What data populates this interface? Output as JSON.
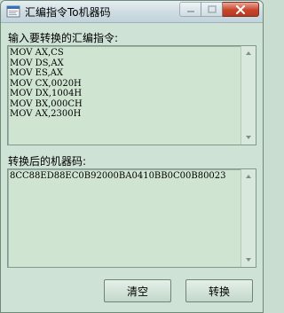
{
  "window": {
    "title": "汇编指令To机器码"
  },
  "input_section": {
    "label": "输入要转换的汇编指令:",
    "content": "MOV AX,CS\nMOV DS,AX\nMOV ES,AX\nMOV CX,0020H\nMOV DX,1004H\nMOV BX,000CH\nMOV AX,2300H"
  },
  "output_section": {
    "label": "转换后的机器码:",
    "content": "8CC88ED88EC0B92000BA0410BB0C00B80023"
  },
  "buttons": {
    "clear_label": "清空",
    "convert_label": "转换"
  }
}
